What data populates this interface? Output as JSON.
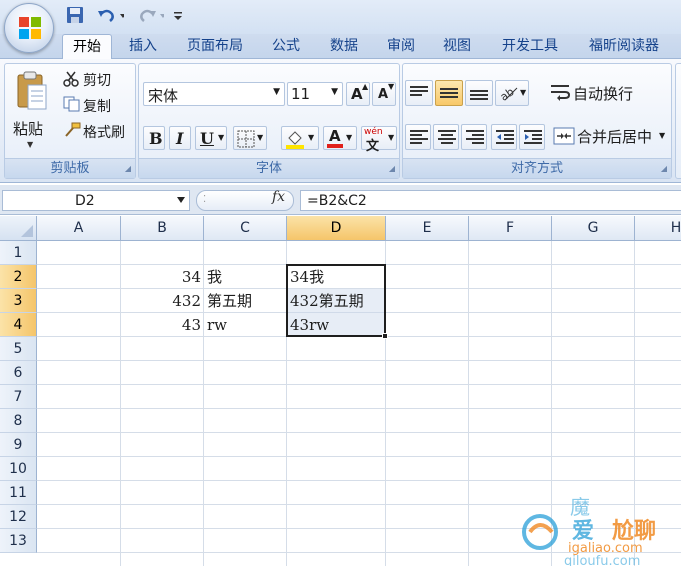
{
  "quick_access": {
    "save_icon": "save-icon",
    "undo_icon": "undo-icon",
    "redo_icon": "redo-icon",
    "customize_icon": "customize-icon"
  },
  "tabs": [
    {
      "label": "开始"
    },
    {
      "label": "插入"
    },
    {
      "label": "页面布局"
    },
    {
      "label": "公式"
    },
    {
      "label": "数据"
    },
    {
      "label": "审阅"
    },
    {
      "label": "视图"
    },
    {
      "label": "开发工具"
    },
    {
      "label": "福昕阅读器"
    }
  ],
  "ribbon": {
    "clipboard": {
      "group_label": "剪贴板",
      "paste": "粘贴",
      "cut": "剪切",
      "copy": "复制",
      "format_painter": "格式刷"
    },
    "font": {
      "group_label": "字体",
      "font_name": "宋体",
      "font_size": "11",
      "bold": "B",
      "italic": "I",
      "underline": "U",
      "font_color_letter": "A",
      "grow_letter": "A",
      "shrink_letter": "A",
      "phonetic": "wén"
    },
    "alignment": {
      "group_label": "对齐方式",
      "wrap_text": "自动换行",
      "merge_center": "合并后居中"
    }
  },
  "formula_bar": {
    "name_box": "D2",
    "fx_label": "fx",
    "formula": "=B2&C2"
  },
  "columns": [
    "A",
    "B",
    "C",
    "D",
    "E",
    "F",
    "G",
    "H"
  ],
  "selected_column": "D",
  "rows": [
    "1",
    "2",
    "3",
    "4",
    "5",
    "6",
    "7",
    "8",
    "9",
    "10",
    "11",
    "12",
    "13"
  ],
  "cells": {
    "B2": "34",
    "C2": "我",
    "D2": "34我",
    "B3": "432",
    "C3": "第五期",
    "D3": "432第五期",
    "B4": "43",
    "C4": "rw",
    "D4": "43rw"
  },
  "selection_range": "D2:D4",
  "colors": {
    "accent": "#15428b",
    "selected_header": "#f5c56a",
    "font_color_bar": "#e0201b",
    "highlight_bar": "#ffe500"
  },
  "watermark": {
    "text1": "魔",
    "text2": "爱",
    "text3": "尬聊",
    "url": "igaliao.com",
    "url2": "qiloufu.com"
  }
}
